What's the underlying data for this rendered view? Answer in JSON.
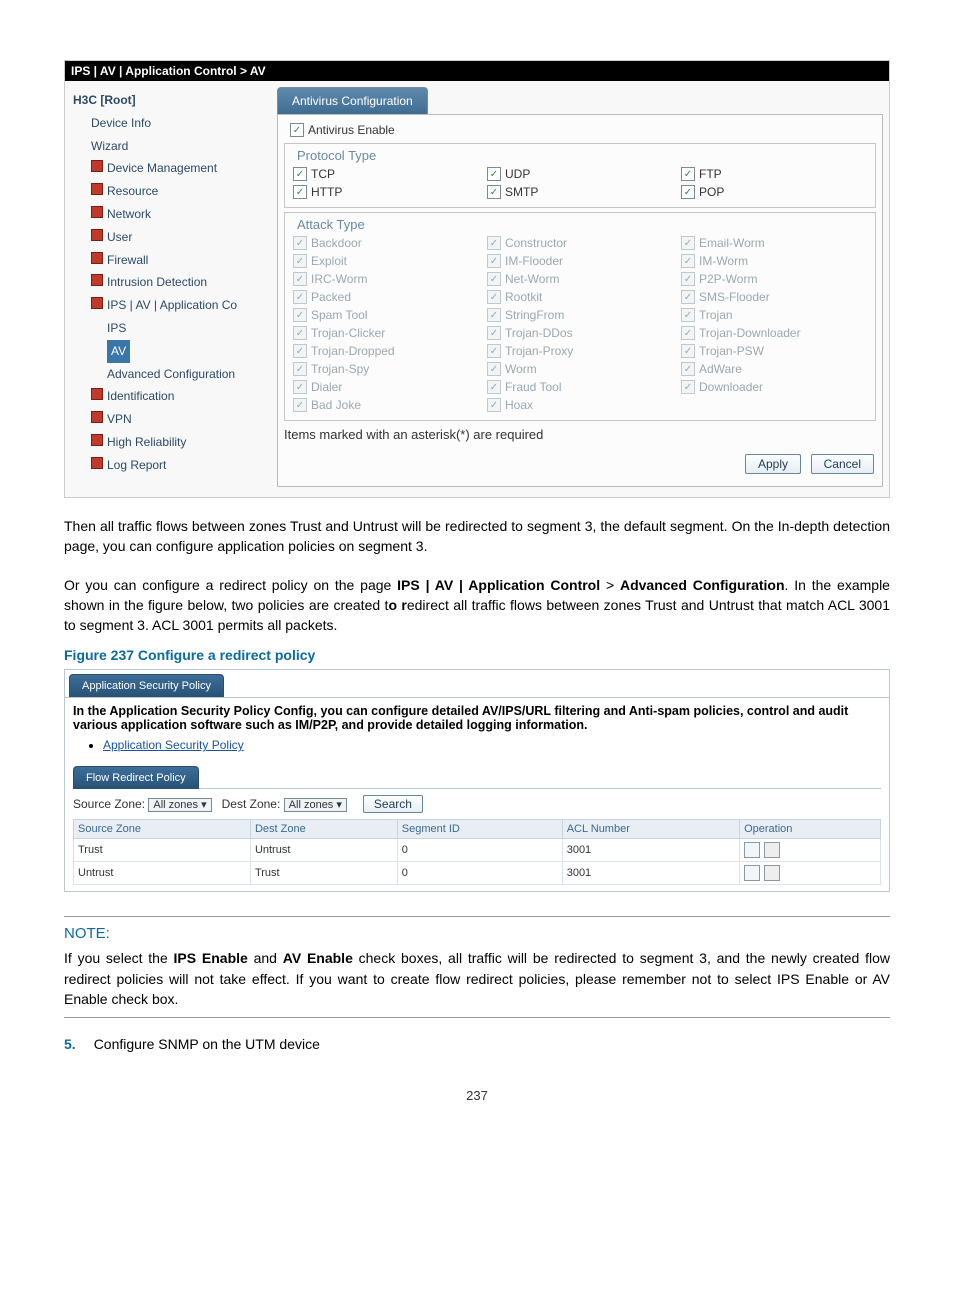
{
  "panel1": {
    "breadcrumb": "IPS | AV | Application Control > AV",
    "tree": {
      "root": "H3C [Root]",
      "items": [
        {
          "label": "Device Info",
          "lvl": 1,
          "folder": false
        },
        {
          "label": "Wizard",
          "lvl": 1,
          "folder": false
        },
        {
          "label": "Device Management",
          "lvl": 1,
          "folder": true
        },
        {
          "label": "Resource",
          "lvl": 1,
          "folder": true
        },
        {
          "label": "Network",
          "lvl": 1,
          "folder": true
        },
        {
          "label": "User",
          "lvl": 1,
          "folder": true
        },
        {
          "label": "Firewall",
          "lvl": 1,
          "folder": true
        },
        {
          "label": "Intrusion Detection",
          "lvl": 1,
          "folder": true
        },
        {
          "label": "IPS | AV | Application Co",
          "lvl": 1,
          "folder": true
        },
        {
          "label": "IPS",
          "lvl": 2,
          "folder": false
        },
        {
          "label": "AV",
          "lvl": 2,
          "folder": false,
          "selected": true
        },
        {
          "label": "Advanced Configuration",
          "lvl": 2,
          "folder": false
        },
        {
          "label": "Identification",
          "lvl": 1,
          "folder": true
        },
        {
          "label": "VPN",
          "lvl": 1,
          "folder": true
        },
        {
          "label": "High Reliability",
          "lvl": 1,
          "folder": true
        },
        {
          "label": "Log Report",
          "lvl": 1,
          "folder": true
        }
      ]
    },
    "tab": "Antivirus Configuration",
    "av_enable": "Antivirus Enable",
    "protocol_legend": "Protocol Type",
    "protocols": [
      "TCP",
      "UDP",
      "FTP",
      "HTTP",
      "SMTP",
      "POP"
    ],
    "attack_legend": "Attack Type",
    "attacks": [
      "Backdoor",
      "Constructor",
      "Email-Worm",
      "Exploit",
      "IM-Flooder",
      "IM-Worm",
      "IRC-Worm",
      "Net-Worm",
      "P2P-Worm",
      "Packed",
      "Rootkit",
      "SMS-Flooder",
      "Spam Tool",
      "StringFrom",
      "Trojan",
      "Trojan-Clicker",
      "Trojan-DDos",
      "Trojan-Downloader",
      "Trojan-Dropped",
      "Trojan-Proxy",
      "Trojan-PSW",
      "Trojan-Spy",
      "Worm",
      "AdWare",
      "Dialer",
      "Fraud Tool",
      "Downloader",
      "Bad Joke",
      "Hoax"
    ],
    "hint": "Items marked with an asterisk(*) are required",
    "apply": "Apply",
    "cancel": "Cancel"
  },
  "para1": "Then all traffic flows between zones Trust and Untrust will be redirected to segment 3, the default segment. On the In-depth detection page, you can configure application policies on segment 3.",
  "para2_a": "Or you can configure a redirect policy on the page ",
  "para2_b_bold": "IPS | AV | Application Control",
  "para2_c": " > ",
  "para2_d_bold": "Advanced Configuration",
  "para2_e": ". In the example shown in the figure below, two policies are created t",
  "para2_f_bold": "o r",
  "para2_g": "edirect all traffic flows between zones Trust and Untrust that match ACL 3001 to segment 3. ACL 3001 permits all packets.",
  "fig_caption": "Figure 237 Configure a redirect policy",
  "panel2": {
    "tab1": "Application Security Policy",
    "desc": "In the Application Security Policy Config, you can configure detailed AV/IPS/URL filtering and Anti-spam policies, control and audit various application software such as IM/P2P, and provide detailed logging information.",
    "link": "Application Security Policy",
    "tab2": "Flow Redirect Policy",
    "src_label": "Source Zone:",
    "dst_label": "Dest Zone:",
    "zone_opt": "All zones",
    "search": "Search",
    "cols": [
      "Source Zone",
      "Dest Zone",
      "Segment ID",
      "ACL Number",
      "Operation"
    ],
    "rows": [
      {
        "src": "Trust",
        "dst": "Untrust",
        "seg": "0",
        "acl": "3001"
      },
      {
        "src": "Untrust",
        "dst": "Trust",
        "seg": "0",
        "acl": "3001"
      }
    ]
  },
  "note_title": "NOTE:",
  "note_a": "If you select the ",
  "note_b_bold": "IPS Enable",
  "note_c": " and ",
  "note_d_bold": "AV Enable",
  "note_e": " check boxes, all traffic will be redirected to segment 3, and the newly created flow redirect policies will not take effect. If you want to create flow redirect policies, please remember not to select IPS Enable or AV Enable check box.",
  "step_no": "5.",
  "step_text": "Configure SNMP on the UTM device",
  "page_no": "237"
}
